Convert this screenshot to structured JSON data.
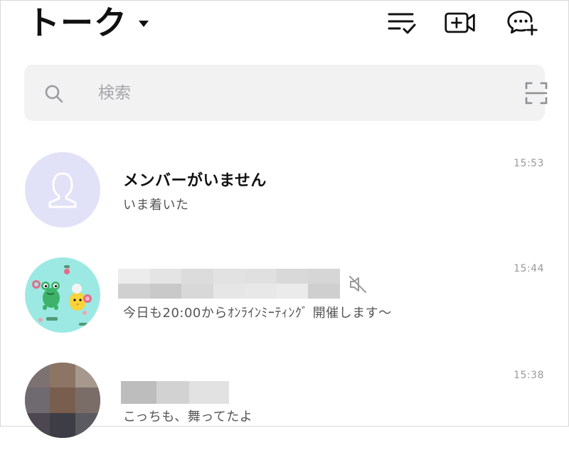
{
  "header": {
    "title": "トーク",
    "icons": [
      "checklist-icon",
      "video-call-add-icon",
      "new-chat-icon"
    ]
  },
  "search": {
    "placeholder": "検索"
  },
  "chats": [
    {
      "name": "メンバーがいません",
      "message": "いま着いた",
      "time": "15:53",
      "muted": false
    },
    {
      "name": "",
      "message": "今日も20:00からｵﾝﾗｲﾝﾐｰﾃｨﾝｸﾞ 開催します〜",
      "time": "15:44",
      "muted": true
    },
    {
      "name": "",
      "message": "こっちも、舞ってたよ",
      "time": "15:38",
      "muted": false
    }
  ],
  "colors": {
    "default_avatar_bg": "#e1e1f8",
    "default_avatar_fg": "#ffffff",
    "avatar2_bg": "#9ce9e4",
    "search_bg": "#f2f2f3"
  }
}
